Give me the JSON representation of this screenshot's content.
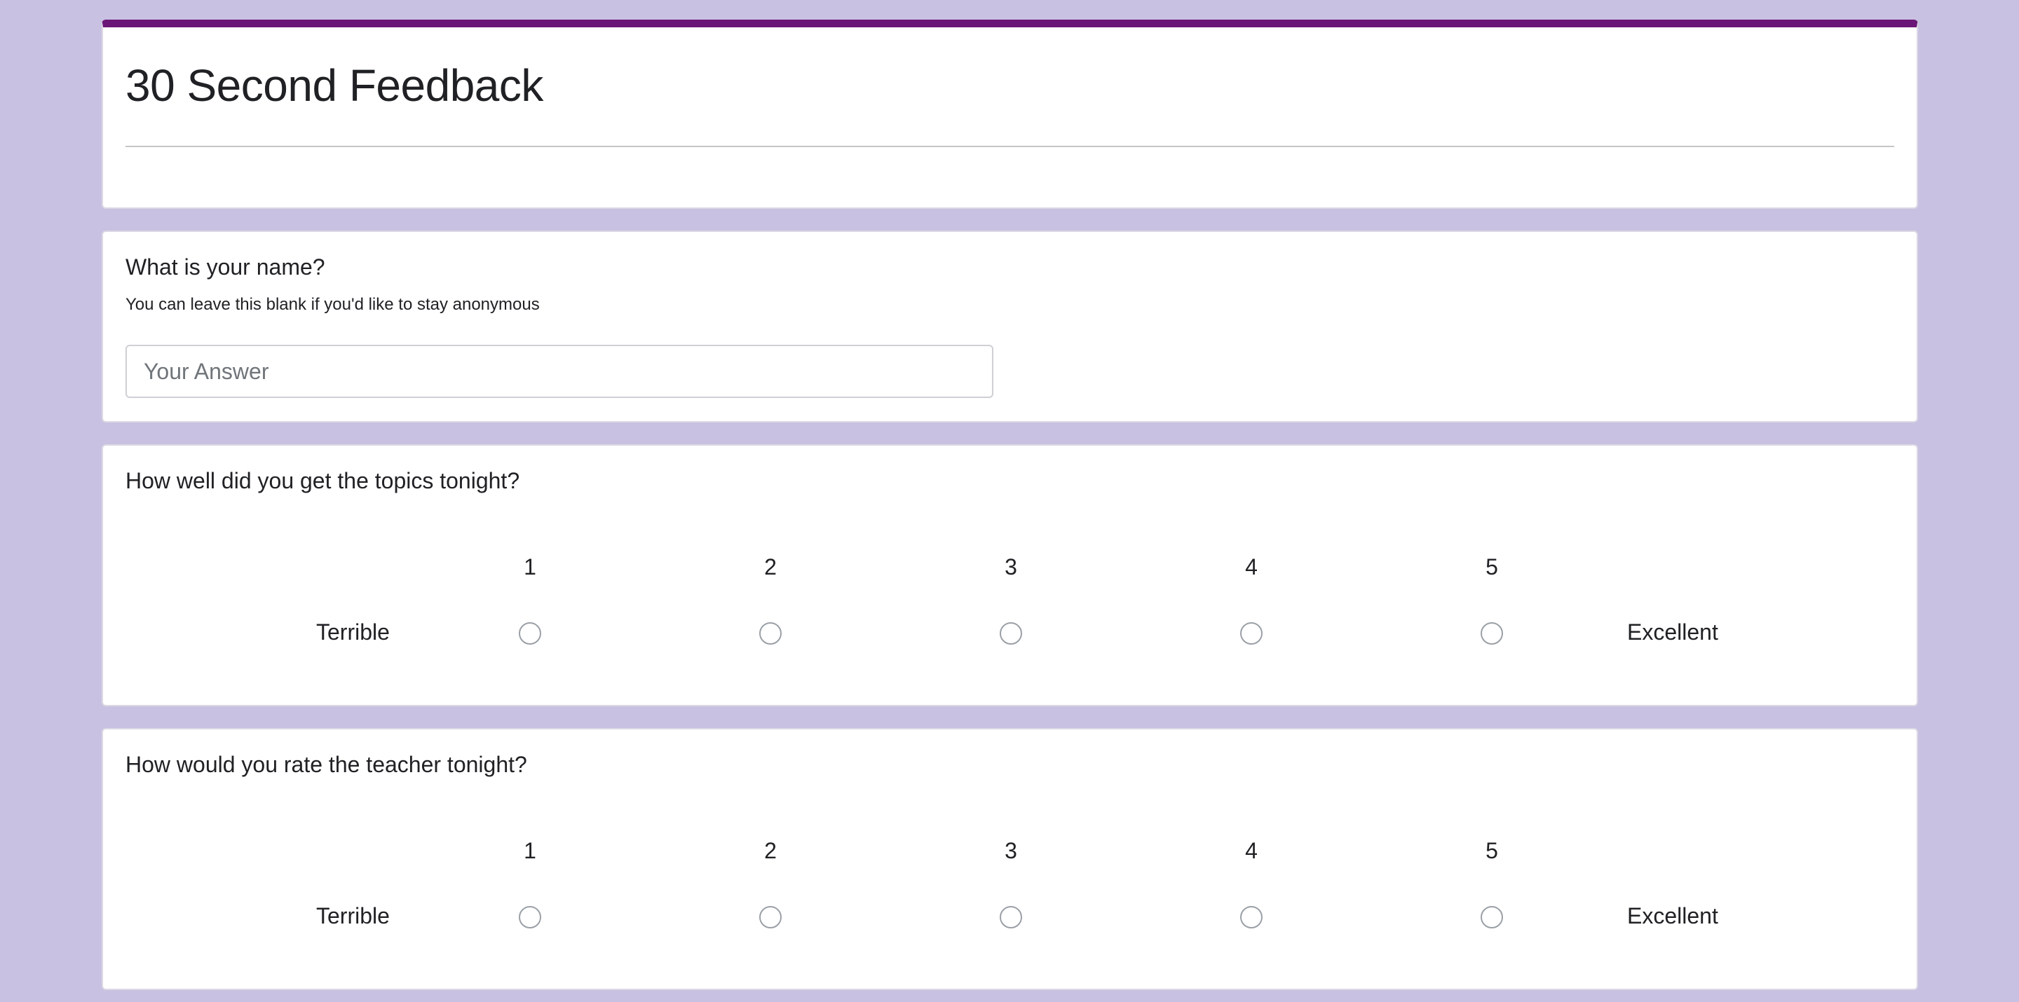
{
  "form": {
    "title": "30 Second Feedback",
    "accent_color": "#6b1577",
    "background_color": "#c9c1e1"
  },
  "questions": [
    {
      "type": "short-answer",
      "title": "What is your name?",
      "description": "You can leave this blank if you'd like to stay anonymous",
      "placeholder": "Your Answer",
      "value": ""
    },
    {
      "type": "linear-scale",
      "title": "How well did you get the topics tonight?",
      "scale": [
        "1",
        "2",
        "3",
        "4",
        "5"
      ],
      "low_label": "Terrible",
      "high_label": "Excellent",
      "selected": null
    },
    {
      "type": "linear-scale",
      "title": "How would you rate the teacher tonight?",
      "scale": [
        "1",
        "2",
        "3",
        "4",
        "5"
      ],
      "low_label": "Terrible",
      "high_label": "Excellent",
      "selected": null
    }
  ]
}
